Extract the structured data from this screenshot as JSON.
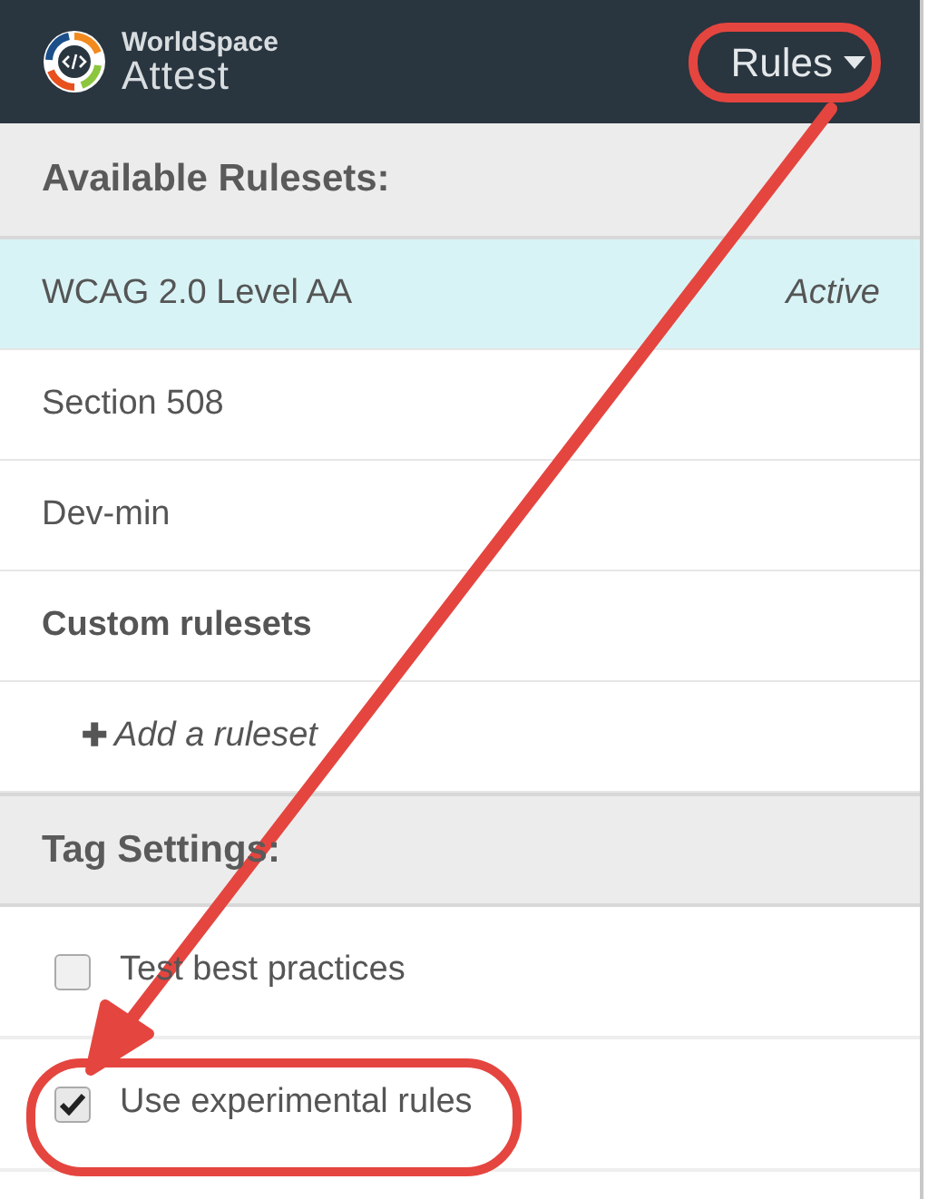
{
  "header": {
    "logo_line_1": "WorldSpace",
    "logo_line_2": "Attest",
    "menu": "Rules"
  },
  "rulesets": {
    "title": "Available Rulesets:",
    "items": [
      {
        "kind": "ruleset",
        "label": "WCAG 2.0 Level AA",
        "selected": true,
        "badge": "Active"
      },
      {
        "kind": "ruleset",
        "label": "Section 508",
        "selected": false
      },
      {
        "kind": "ruleset",
        "label": "Dev-min",
        "selected": false
      },
      {
        "kind": "group",
        "label": "Custom rulesets"
      },
      {
        "kind": "add",
        "icon": "✚",
        "label": "Add a ruleset"
      }
    ]
  },
  "tag_settings": {
    "title": "Tag Settings:",
    "items": [
      {
        "label": "Test best practices",
        "checked": false
      },
      {
        "label": "Use experimental rules",
        "checked": true
      }
    ]
  }
}
